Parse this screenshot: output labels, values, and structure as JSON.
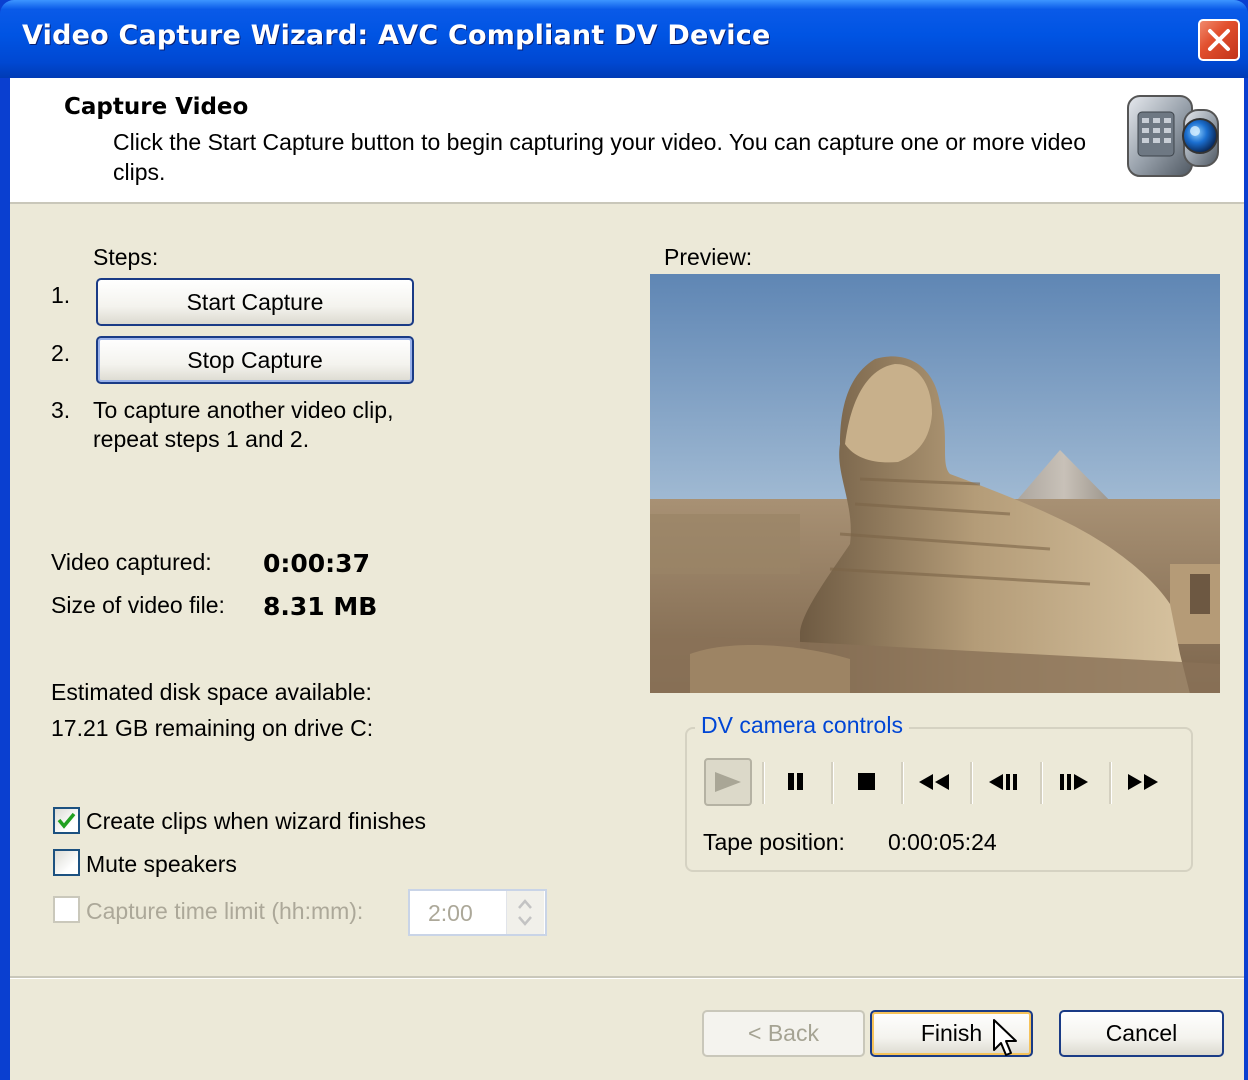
{
  "window": {
    "title": "Video Capture Wizard: AVC Compliant DV Device"
  },
  "header": {
    "title": "Capture Video",
    "description": "Click the Start Capture button to begin capturing your video. You can capture one or more video clips."
  },
  "steps": {
    "label": "Steps:",
    "step1_num": "1.",
    "step1_button": "Start Capture",
    "step2_num": "2.",
    "step2_button": "Stop Capture",
    "step3_num": "3.",
    "step3_line1": "To capture another video clip,",
    "step3_line2": "repeat steps 1 and 2."
  },
  "stats": {
    "video_captured_label": "Video captured:",
    "video_captured_value": "0:00:37",
    "size_label": "Size of video file:",
    "size_value": "8.31 MB",
    "disk_label": "Estimated disk space available:",
    "disk_value": "17.21 GB remaining on drive C:"
  },
  "options": {
    "create_clips_label": "Create clips when wizard finishes",
    "create_clips_checked": true,
    "mute_label": "Mute speakers",
    "mute_checked": false,
    "time_limit_label": "Capture time limit (hh:mm):",
    "time_limit_checked": false,
    "time_limit_value": "2:00"
  },
  "preview": {
    "label": "Preview:"
  },
  "dv_controls": {
    "legend": "DV camera controls",
    "buttons": [
      "play-icon",
      "pause-icon",
      "stop-icon",
      "rewind-icon",
      "previous-frame-icon",
      "next-frame-icon",
      "fast-forward-icon"
    ],
    "tape_position_label": "Tape position:",
    "tape_position_value": "0:00:05:24"
  },
  "footer": {
    "back_label": "< Back",
    "finish_label": "Finish",
    "cancel_label": "Cancel"
  },
  "colors": {
    "title_bar": "#0054e3",
    "dialog_bg": "#ece9d8",
    "legend_text": "#0046d5",
    "checkmark": "#21a121"
  }
}
